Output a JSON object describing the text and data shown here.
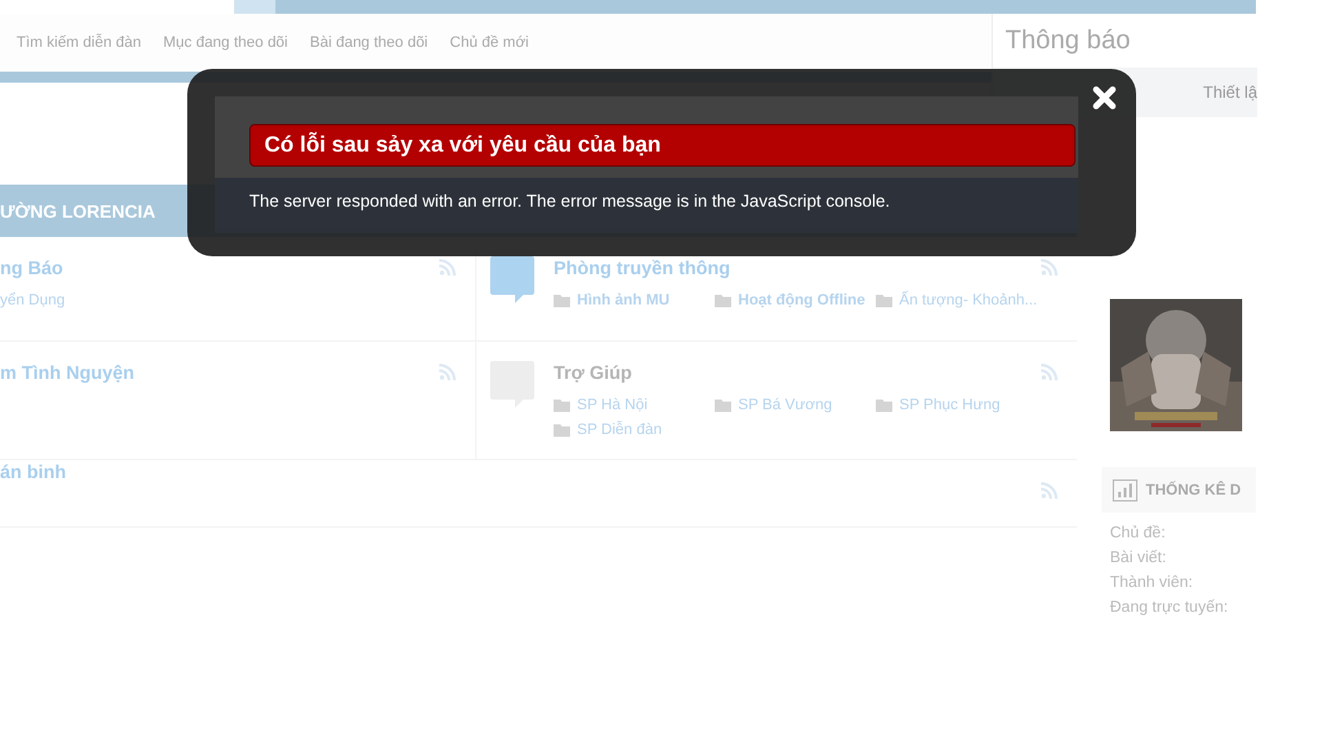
{
  "nav": {
    "links": [
      "Tìm kiếm diễn đàn",
      "Mục đang theo dõi",
      "Bài đang theo dõi",
      "Chủ đề mới"
    ]
  },
  "notifications": {
    "title": "Thông báo",
    "links": [
      "Thiết lậ"
    ]
  },
  "category": {
    "title": "ƯỜNG LORENCIA",
    "rows": [
      [
        {
          "kind": "cut",
          "title": "ng Báo",
          "unread": true,
          "subforums": [
            {
              "label": "yển Dụng",
              "unread": false
            }
          ]
        },
        {
          "kind": "whole",
          "title": "Phòng truyền thông",
          "unread": true,
          "subforums": [
            {
              "label": "Hình ảnh MU",
              "unread": true
            },
            {
              "label": "Hoạt động Offline",
              "unread": true
            },
            {
              "label": "Ấn tượng- Khoảnh...",
              "unread": false
            }
          ]
        }
      ],
      [
        {
          "kind": "cut",
          "title": "m Tình Nguyện",
          "unread": true
        },
        {
          "kind": "whole",
          "title": "Trợ Giúp",
          "unread": false,
          "subforums": [
            {
              "label": "SP Hà Nội",
              "unread": false
            },
            {
              "label": "SP Bá Vương",
              "unread": false
            },
            {
              "label": "SP Phục Hưng",
              "unread": false
            },
            {
              "label": "SP Diễn đàn",
              "unread": false
            }
          ]
        }
      ],
      [
        {
          "kind": "cut",
          "title": "án binh",
          "unread": true
        }
      ]
    ]
  },
  "sidebar": {
    "stats": {
      "title": "THỐNG KÊ D",
      "labels": [
        "Chủ đề:",
        "Bài viết:",
        "Thành viên:",
        "Đang trực tuyến:"
      ]
    }
  },
  "dialog": {
    "title": "Có lỗi sau sảy xa với yêu cầu của bạn",
    "message": "The server responded with an error. The error message is in the JavaScript console."
  }
}
